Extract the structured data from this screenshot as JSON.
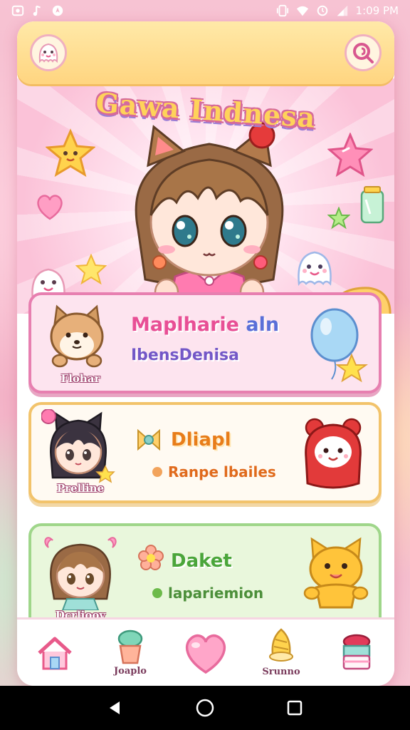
{
  "status_bar": {
    "time": "1:09 PM",
    "left_icons": [
      "notification-icon",
      "music-note-icon",
      "location-icon"
    ],
    "right_icons": [
      "vibrate-icon",
      "wifi-icon",
      "alarm-icon",
      "signal-icon"
    ]
  },
  "header": {
    "left_button_icon": "ghost-face-icon",
    "right_button_icon": "swirl-search-icon"
  },
  "hero": {
    "title": "Gawa Indnesa"
  },
  "cards": [
    {
      "title_part_a": "Maplharie",
      "title_part_b": "aln",
      "subtitle": "IbensDenisa",
      "avatar_label": "Flohar",
      "deco_icon": "balloon-icon"
    },
    {
      "title": "Dliapl",
      "subtitle": "Ranpe lbailes",
      "avatar_label": "Prelline",
      "deco_icon": "red-bear-icon",
      "title_icon": "ribbon-icon"
    },
    {
      "title": "Daket",
      "subtitle": "lapariemion",
      "avatar_label": "Dcrlioov",
      "deco_icon": "yellow-cat-icon",
      "title_icon": "flower-icon"
    }
  ],
  "bottom_nav": {
    "items": [
      {
        "icon": "house-icon",
        "label": ""
      },
      {
        "icon": "plant-pot-icon",
        "label": "Joaplo"
      },
      {
        "icon": "heart-icon",
        "label": ""
      },
      {
        "icon": "ice-cream-icon",
        "label": "Srunno"
      },
      {
        "icon": "cake-icon",
        "label": ""
      }
    ]
  },
  "system_nav": [
    "back-icon",
    "home-circle-icon",
    "recents-icon"
  ],
  "colors": {
    "accent_pink": "#e84f95",
    "header_yellow": "#ffd580",
    "card1_border": "#e77fb0",
    "card2_border": "#f2c36b",
    "card3_border": "#9fd68a"
  }
}
